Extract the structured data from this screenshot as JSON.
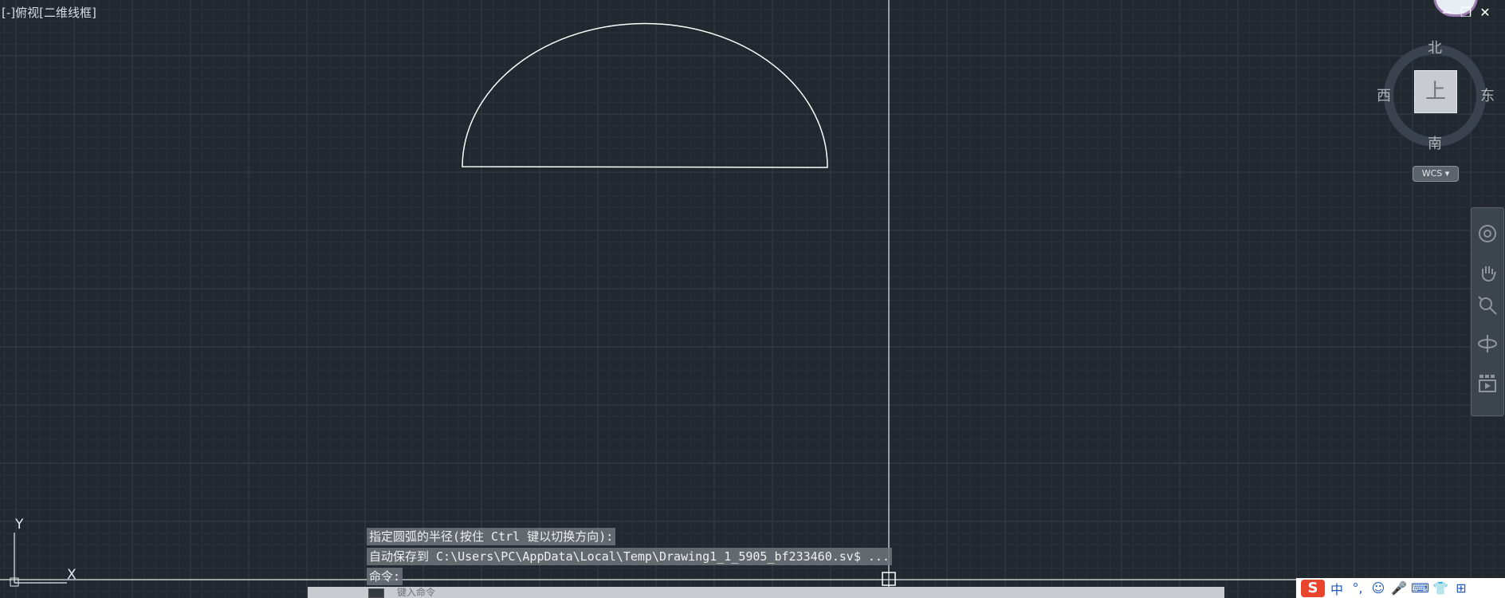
{
  "viewport": {
    "label": "[-]俯视[二维线框]"
  },
  "window_controls": {
    "minimize": "−",
    "restore": "❐",
    "close": "✕"
  },
  "viewcube": {
    "north": "北",
    "south": "南",
    "west": "西",
    "east": "东",
    "face": "上",
    "wcs": "WCS ▾"
  },
  "ucs": {
    "x_label": "X",
    "y_label": "Y"
  },
  "command_history": [
    "指定圆弧的半径(按住 Ctrl 键以切换方向):",
    "自动保存到 C:\\Users\\PC\\AppData\\Local\\Temp\\Drawing1_1_5905_bf233460.sv$ ...",
    "命令:"
  ],
  "command_bar": {
    "prompt": "键入命令"
  },
  "tray": {
    "logo": "S",
    "items": [
      "中",
      "°,",
      "☺",
      "🎤",
      "⌨",
      "👕",
      "⊞"
    ]
  },
  "colors": {
    "background": "#212830",
    "grid_minor": "#2a3139",
    "grid_major": "#35404a",
    "geometry": "#ffffff"
  }
}
